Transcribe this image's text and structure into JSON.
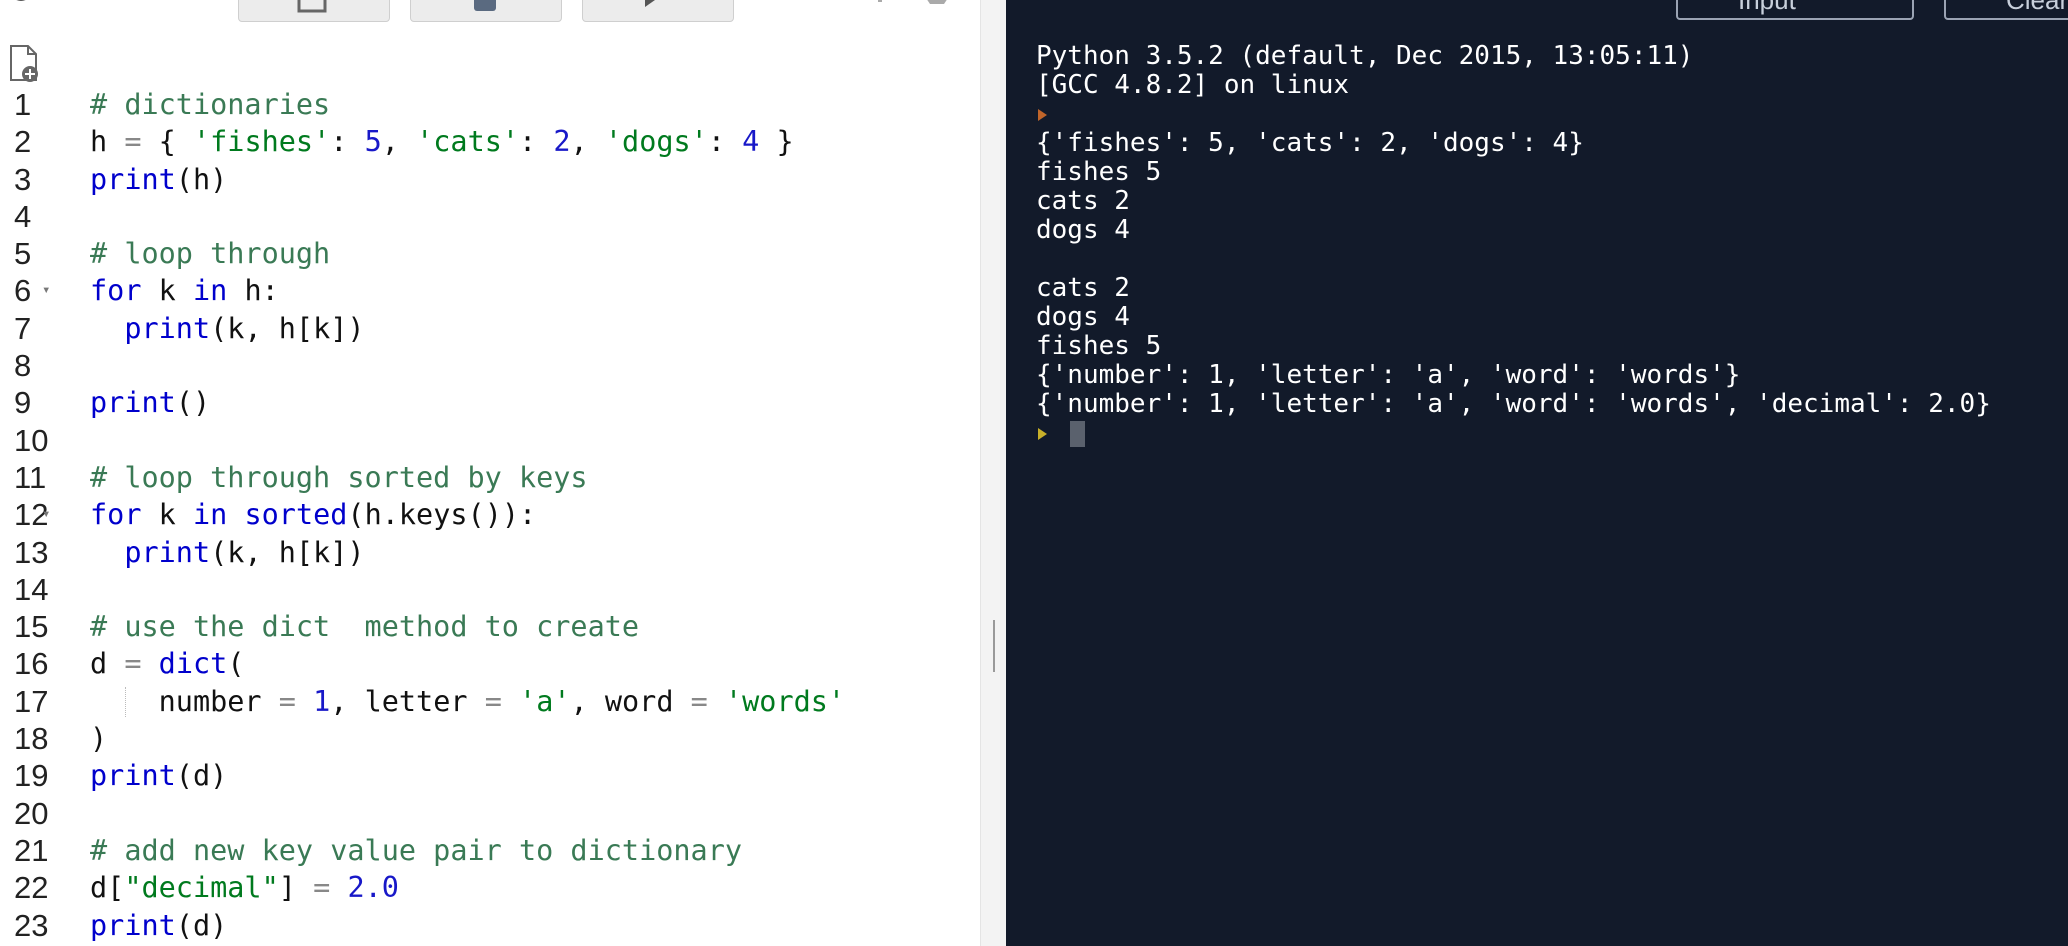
{
  "editor": {
    "lines": [
      {
        "n": "1",
        "tokens": [
          [
            "cm",
            "# dictionaries"
          ]
        ]
      },
      {
        "n": "2",
        "tokens": [
          [
            "",
            "h "
          ],
          [
            "op",
            "="
          ],
          [
            "",
            " { "
          ],
          [
            "st",
            "'fishes'"
          ],
          [
            "",
            ": "
          ],
          [
            "nu",
            "5"
          ],
          [
            "",
            ", "
          ],
          [
            "st",
            "'cats'"
          ],
          [
            "",
            ": "
          ],
          [
            "nu",
            "2"
          ],
          [
            "",
            ", "
          ],
          [
            "st",
            "'dogs'"
          ],
          [
            "",
            ": "
          ],
          [
            "nu",
            "4"
          ],
          [
            "",
            " }"
          ]
        ]
      },
      {
        "n": "3",
        "tokens": [
          [
            "kw",
            "print"
          ],
          [
            "",
            "(h)"
          ]
        ]
      },
      {
        "n": "4",
        "tokens": []
      },
      {
        "n": "5",
        "tokens": [
          [
            "cm",
            "# loop through"
          ]
        ]
      },
      {
        "n": "6",
        "fold": true,
        "tokens": [
          [
            "kw",
            "for"
          ],
          [
            "",
            " k "
          ],
          [
            "kw",
            "in"
          ],
          [
            "",
            " h:"
          ]
        ]
      },
      {
        "n": "7",
        "tokens": [
          [
            "",
            "  "
          ],
          [
            "kw",
            "print"
          ],
          [
            "",
            "(k, h[k])"
          ]
        ]
      },
      {
        "n": "8",
        "tokens": []
      },
      {
        "n": "9",
        "tokens": [
          [
            "kw",
            "print"
          ],
          [
            "",
            "()"
          ]
        ]
      },
      {
        "n": "10",
        "tokens": []
      },
      {
        "n": "11",
        "tokens": [
          [
            "cm",
            "# loop through sorted by keys"
          ]
        ]
      },
      {
        "n": "12",
        "fold": true,
        "tokens": [
          [
            "kw",
            "for"
          ],
          [
            "",
            " k "
          ],
          [
            "kw",
            "in"
          ],
          [
            "",
            " "
          ],
          [
            "kw",
            "sorted"
          ],
          [
            "",
            "(h.keys()):"
          ]
        ]
      },
      {
        "n": "13",
        "tokens": [
          [
            "",
            "  "
          ],
          [
            "kw",
            "print"
          ],
          [
            "",
            "(k, h[k])"
          ]
        ]
      },
      {
        "n": "14",
        "tokens": []
      },
      {
        "n": "15",
        "tokens": [
          [
            "cm",
            "# use the dict  method to create"
          ]
        ]
      },
      {
        "n": "16",
        "tokens": [
          [
            "",
            "d "
          ],
          [
            "op",
            "="
          ],
          [
            "",
            " "
          ],
          [
            "kw",
            "dict"
          ],
          [
            "",
            "("
          ]
        ]
      },
      {
        "n": "17",
        "guide": true,
        "tokens": [
          [
            "",
            "    number "
          ],
          [
            "op",
            "="
          ],
          [
            "",
            " "
          ],
          [
            "nu",
            "1"
          ],
          [
            "",
            ", letter "
          ],
          [
            "op",
            "="
          ],
          [
            "",
            " "
          ],
          [
            "st",
            "'a'"
          ],
          [
            "",
            ", word "
          ],
          [
            "op",
            "="
          ],
          [
            "",
            " "
          ],
          [
            "st",
            "'words'"
          ]
        ]
      },
      {
        "n": "18",
        "tokens": [
          [
            "",
            ")"
          ]
        ]
      },
      {
        "n": "19",
        "tokens": [
          [
            "kw",
            "print"
          ],
          [
            "",
            "(d)"
          ]
        ]
      },
      {
        "n": "20",
        "tokens": []
      },
      {
        "n": "21",
        "tokens": [
          [
            "cm",
            "# add new key value pair to dictionary"
          ]
        ]
      },
      {
        "n": "22",
        "tokens": [
          [
            "",
            "d["
          ],
          [
            "st",
            "\"decimal\""
          ],
          [
            "",
            "] "
          ],
          [
            "op",
            "="
          ],
          [
            "",
            " "
          ],
          [
            "nu",
            "2.0"
          ]
        ]
      },
      {
        "n": "23",
        "tokens": [
          [
            "kw",
            "print"
          ],
          [
            "",
            "(d)"
          ]
        ]
      }
    ]
  },
  "console": {
    "input_button": "Input",
    "clear_button": "Clear",
    "header": [
      "Python 3.5.2 (default, Dec 2015, 13:05:11)",
      "[GCC 4.8.2] on linux"
    ],
    "output": [
      "{'fishes': 5, 'cats': 2, 'dogs': 4}",
      "fishes 5",
      "cats 2",
      "dogs 4",
      "",
      "cats 2",
      "dogs 4",
      "fishes 5",
      "{'number': 1, 'letter': 'a', 'word': 'words'}",
      "{'number': 1, 'letter': 'a', 'word': 'words', 'decimal': 2.0}"
    ]
  },
  "colors": {
    "console_bg": "#121a2a",
    "comment": "#3a7a55",
    "keyword": "#0000cc",
    "string": "#007a1e",
    "number": "#1818c8"
  }
}
